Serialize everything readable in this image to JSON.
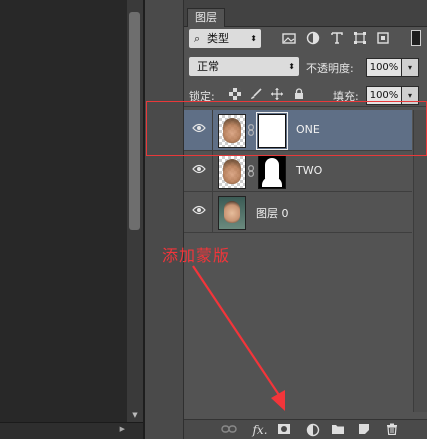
{
  "panel": {
    "tab_label": "图层",
    "filter": {
      "label": "类型"
    },
    "filter_icons": [
      "image-filter-icon",
      "adjustment-filter-icon",
      "text-filter-icon",
      "shape-filter-icon",
      "smart-object-filter-icon"
    ],
    "blend_mode": "正常",
    "opacity_label": "不透明度:",
    "opacity_value": "100%",
    "lock_label": "锁定:",
    "fill_label": "填充:",
    "fill_value": "100%",
    "layers": [
      {
        "name": "ONE",
        "selected": true,
        "has_mask": true,
        "mask_style": "white"
      },
      {
        "name": "TWO",
        "selected": false,
        "has_mask": true,
        "mask_style": "silhouette"
      },
      {
        "name": "图层 0",
        "selected": false,
        "has_mask": false
      }
    ],
    "bottom_icons": [
      "link-layers-icon",
      "fx-icon",
      "add-mask-icon",
      "adjustment-layer-icon",
      "new-group-icon",
      "new-layer-icon",
      "delete-layer-icon"
    ]
  },
  "annotation": {
    "text": "添加蒙版",
    "color": "#f2353a"
  },
  "colors": {
    "panel_bg": "#535353",
    "selected_row": "#5f6f86",
    "highlight": "#e8393a"
  },
  "glyphs": {
    "fx": "fx.",
    "magnifier": "⌕",
    "updown": "⬍",
    "down": "▾"
  }
}
